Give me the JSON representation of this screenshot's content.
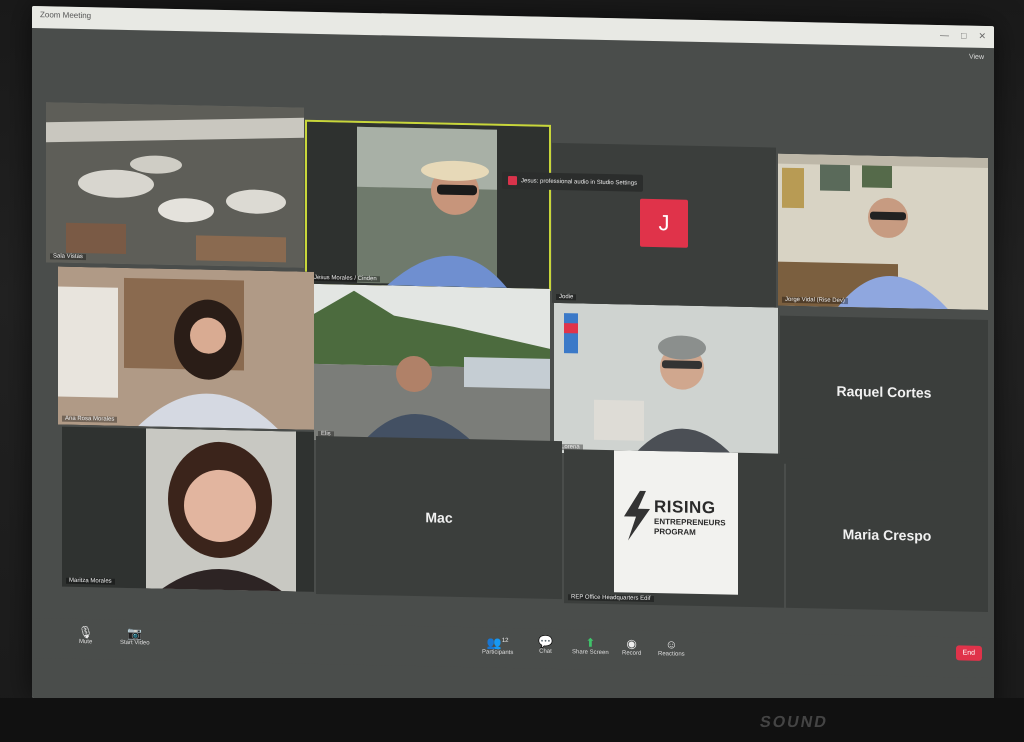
{
  "window": {
    "title": "Zoom Meeting",
    "view_label": "View",
    "controls": [
      "—",
      "□",
      "✕"
    ]
  },
  "notification": {
    "text": "Jesus: professional audio in Studio Settings"
  },
  "participants": {
    "p1": {
      "name": "Sala Vistas"
    },
    "p2": {
      "name": "Jesus Morales / Cinden"
    },
    "p3": {
      "name": "Jodie",
      "initial": "J"
    },
    "p4": {
      "name": "Jorge Vidal (Rise Dev)"
    },
    "p5": {
      "name": "Ana Rosa Morales"
    },
    "p6": {
      "name": "Elis"
    },
    "p7": {
      "name": "Lorena"
    },
    "p8": {
      "name": "Raquel Cortes"
    },
    "p9": {
      "name": "Maritza Morales"
    },
    "p10": {
      "name": "Mac"
    },
    "p11": {
      "name": "REP Office Headquarters Edif"
    },
    "p12": {
      "name": "Maria Crespo"
    }
  },
  "logo": {
    "line1": "RISING",
    "line2": "ENTREPRENEURS",
    "line3": "PROGRAM"
  },
  "toolbar": {
    "mute": "Mute",
    "video": "Start Video",
    "participants": "Participants",
    "participants_count": "12",
    "chat": "Chat",
    "share": "Share Screen",
    "record": "Record",
    "reactions": "Reactions",
    "end": "End"
  },
  "colors": {
    "accent": "#e0334a",
    "active": "#c8d63a"
  }
}
